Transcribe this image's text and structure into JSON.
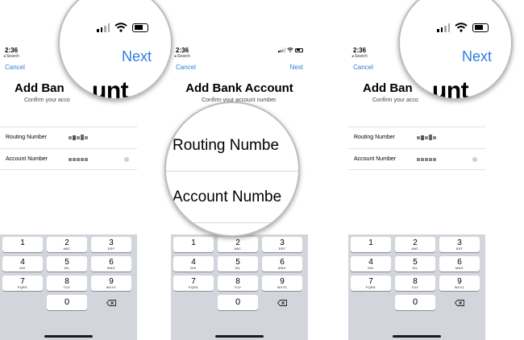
{
  "status": {
    "time": "2:36",
    "back_link": "◂ Search"
  },
  "nav": {
    "cancel_label": "Cancel",
    "next_label": "Next"
  },
  "header": {
    "title": "Add Bank Account",
    "title_cropped": "Add Ban",
    "subtitle": "Confirm your account number.",
    "subtitle_cropped": "Confirm your acco"
  },
  "form": {
    "routing_label": "Routing Number",
    "account_label": "Account Number"
  },
  "magnifier": {
    "next_label": "Next",
    "title_crop": "unt",
    "routing_crop": "Routing Numbe",
    "account_crop": "Account Numbe"
  },
  "keypad": {
    "keys": [
      {
        "num": "1",
        "letters": ""
      },
      {
        "num": "2",
        "letters": "ABC"
      },
      {
        "num": "3",
        "letters": "DEF"
      },
      {
        "num": "4",
        "letters": "GHI"
      },
      {
        "num": "5",
        "letters": "JKL"
      },
      {
        "num": "6",
        "letters": "MNO"
      },
      {
        "num": "7",
        "letters": "PQRS"
      },
      {
        "num": "8",
        "letters": "TUV"
      },
      {
        "num": "9",
        "letters": "WXYZ"
      },
      {
        "num": "0",
        "letters": ""
      }
    ]
  },
  "colors": {
    "accent": "#2a7de1",
    "keyboard_bg": "#d2d5db"
  }
}
